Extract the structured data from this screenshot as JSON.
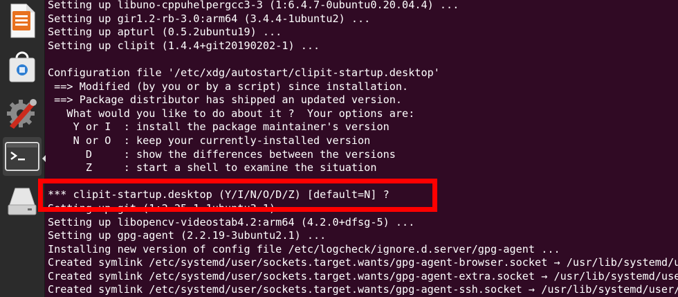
{
  "launcher": {
    "items": [
      {
        "icon": "libreoffice-impress-icon"
      },
      {
        "icon": "software-store-icon"
      },
      {
        "icon": "system-settings-icon"
      },
      {
        "icon": "terminal-icon"
      },
      {
        "icon": "removable-drive-icon"
      }
    ]
  },
  "terminal": {
    "lines": [
      "Setting up libuno-cppuhelpergcc3-3 (1:6.4.7-0ubuntu0.20.04.4) ...",
      "Setting up gir1.2-rb-3.0:arm64 (3.4.4-1ubuntu2) ...",
      "Setting up apturl (0.5.2ubuntu19) ...",
      "Setting up clipit (1.4.4+git20190202-1) ...",
      "",
      "Configuration file '/etc/xdg/autostart/clipit-startup.desktop'",
      " ==> Modified (by you or by a script) since installation.",
      " ==> Package distributor has shipped an updated version.",
      "   What would you like to do about it ?  Your options are:",
      "    Y or I  : install the package maintainer's version",
      "    N or O  : keep your currently-installed version",
      "      D     : show the differences between the versions",
      "      Z     : start a shell to examine the situation",
      "",
      "*** clipit-startup.desktop (Y/I/N/O/D/Z) [default=N] ?",
      "Setting up git (1:2.25.1-1ubuntu3.1) ...",
      "Setting up libopencv-videostab4.2:arm64 (4.2.0+dfsg-5) ...",
      "Setting up gpg-agent (2.2.19-3ubuntu2.1) ...",
      "Installing new version of config file /etc/logcheck/ignore.d.server/gpg-agent ...",
      "Created symlink /etc/systemd/user/sockets.target.wants/gpg-agent-browser.socket → /usr/lib/systemd/user/gpg-agent-browser.socket.",
      "Created symlink /etc/systemd/user/sockets.target.wants/gpg-agent-extra.socket → /usr/lib/systemd/user/gpg-agent-extra.socket.",
      "Created symlink /etc/systemd/user/sockets.target.wants/gpg-agent-ssh.socket → /usr/lib/systemd/user/gpg-agent-ssh.socket."
    ]
  },
  "colors": {
    "terminal_bg": "#300a24",
    "terminal_fg": "#ffffff",
    "highlight": "#ff0000",
    "launcher_bg": "#2b2b2b"
  }
}
